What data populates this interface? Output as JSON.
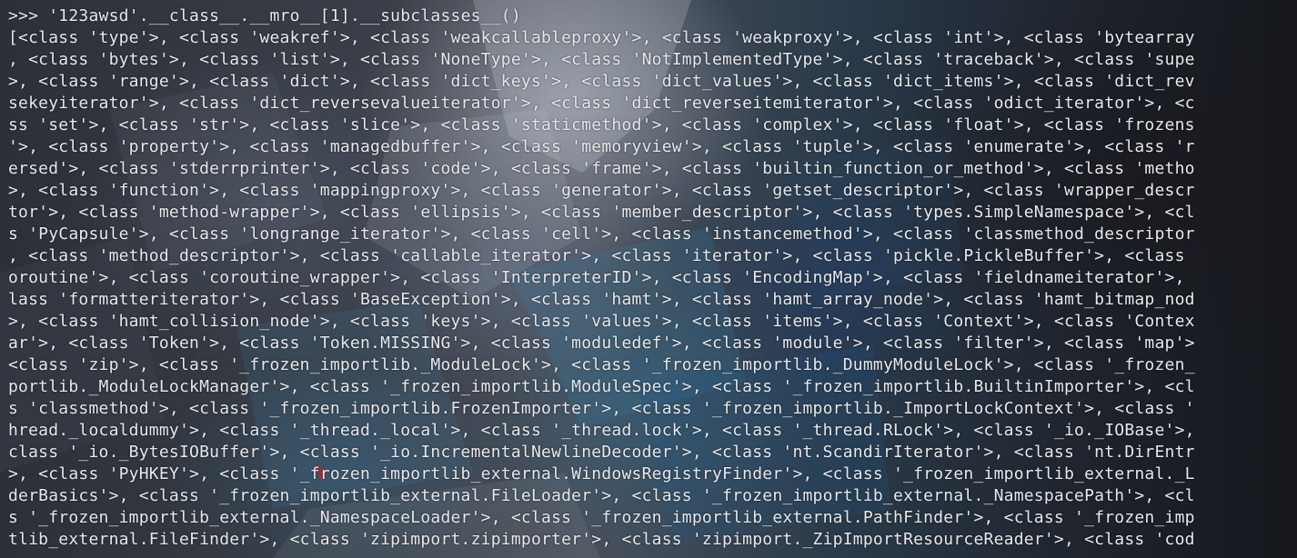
{
  "terminal": {
    "prompt": ">>>",
    "command": "'123awsd'.__class__.__mro__[1].__subclasses__()",
    "output_lines": [
      "[<class 'type'>, <class 'weakref'>, <class 'weakcallableproxy'>, <class 'weakproxy'>, <class 'int'>, <class 'bytearray",
      ", <class 'bytes'>, <class 'list'>, <class 'NoneType'>, <class 'NotImplementedType'>, <class 'traceback'>, <class 'supe",
      ">, <class 'range'>, <class 'dict'>, <class 'dict_keys'>, <class 'dict_values'>, <class 'dict_items'>, <class 'dict_rev",
      "sekeyiterator'>, <class 'dict_reversevalueiterator'>, <class 'dict_reverseitemiterator'>, <class 'odict_iterator'>, <c",
      "ss 'set'>, <class 'str'>, <class 'slice'>, <class 'staticmethod'>, <class 'complex'>, <class 'float'>, <class 'frozens",
      "'>, <class 'property'>, <class 'managedbuffer'>, <class 'memoryview'>, <class 'tuple'>, <class 'enumerate'>, <class 'r",
      "ersed'>, <class 'stderrprinter'>, <class 'code'>, <class 'frame'>, <class 'builtin_function_or_method'>, <class 'metho",
      ">, <class 'function'>, <class 'mappingproxy'>, <class 'generator'>, <class 'getset_descriptor'>, <class 'wrapper_descr",
      "tor'>, <class 'method-wrapper'>, <class 'ellipsis'>, <class 'member_descriptor'>, <class 'types.SimpleNamespace'>, <cl",
      "s 'PyCapsule'>, <class 'longrange_iterator'>, <class 'cell'>, <class 'instancemethod'>, <class 'classmethod_descriptor",
      ", <class 'method_descriptor'>, <class 'callable_iterator'>, <class 'iterator'>, <class 'pickle.PickleBuffer'>, <class",
      "oroutine'>, <class 'coroutine_wrapper'>, <class 'InterpreterID'>, <class 'EncodingMap'>, <class 'fieldnameiterator'>,",
      "lass 'formatteriterator'>, <class 'BaseException'>, <class 'hamt'>, <class 'hamt_array_node'>, <class 'hamt_bitmap_nod",
      ">, <class 'hamt_collision_node'>, <class 'keys'>, <class 'values'>, <class 'items'>, <class 'Context'>, <class 'Contex",
      "ar'>, <class 'Token'>, <class 'Token.MISSING'>, <class 'moduledef'>, <class 'module'>, <class 'filter'>, <class 'map'>",
      "<class 'zip'>, <class '_frozen_importlib._ModuleLock'>, <class '_frozen_importlib._DummyModuleLock'>, <class '_frozen_",
      "portlib._ModuleLockManager'>, <class '_frozen_importlib.ModuleSpec'>, <class '_frozen_importlib.BuiltinImporter'>, <cl",
      "s 'classmethod'>, <class '_frozen_importlib.FrozenImporter'>, <class '_frozen_importlib._ImportLockContext'>, <class '",
      "hread._localdummy'>, <class '_thread._local'>, <class '_thread.lock'>, <class '_thread.RLock'>, <class '_io._IOBase'>,",
      "class '_io._BytesIOBuffer'>, <class '_io.IncrementalNewlineDecoder'>, <class 'nt.ScandirIterator'>, <class 'nt.DirEntr",
      ">, <class 'PyHKEY'>, <class '_frozen_importlib_external.WindowsRegistryFinder'>, <class '_frozen_importlib_external._L",
      "derBasics'>, <class '_frozen_importlib_external.FileLoader'>, <class '_frozen_importlib_external._NamespacePath'>, <cl",
      "s '_frozen_importlib_external._NamespaceLoader'>, <class '_frozen_importlib_external.PathFinder'>, <class '_frozen_imp",
      "tlib_external.FileFinder'>, <class 'zipimport.zipimporter'>, <class 'zipimport._ZipImportResourceReader'>, <class 'cod"
    ],
    "colors": {
      "text": "#e8e8ec",
      "background": "#2a2e36"
    }
  }
}
